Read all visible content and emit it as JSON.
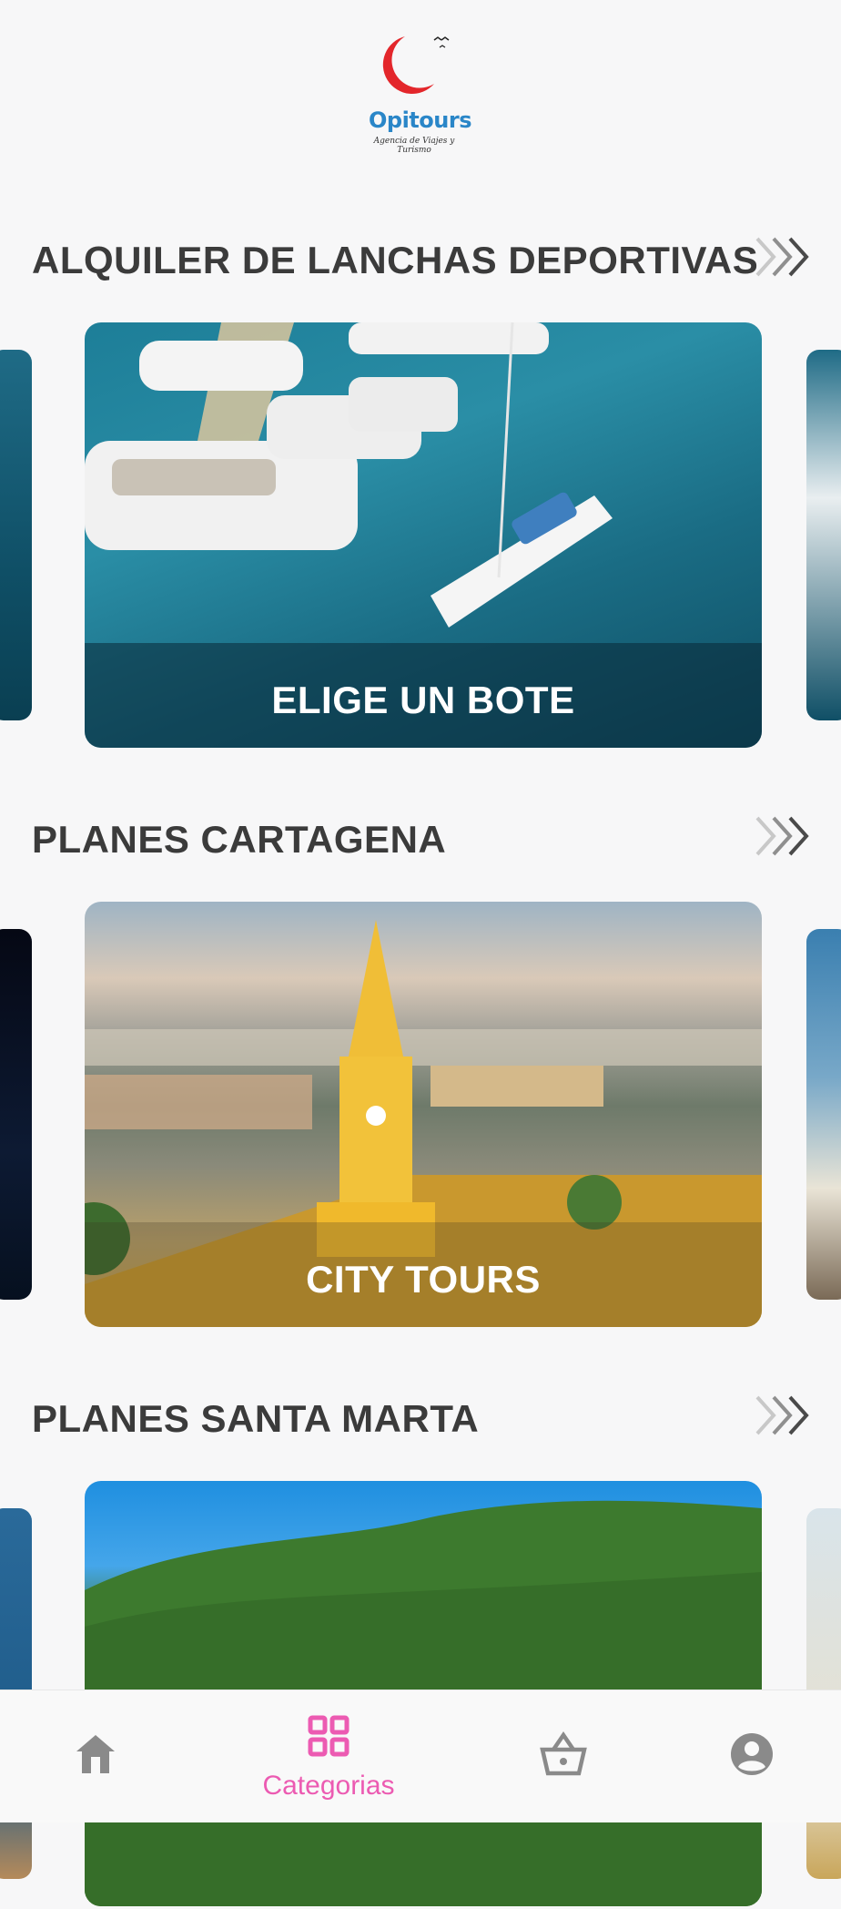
{
  "app": {
    "logo_name": "Opitours",
    "logo_tagline": "Agencia de Viajes y Turismo"
  },
  "sections": [
    {
      "title": "ALQUILER DE  LANCHAS DEPORTIVAS",
      "card_caption": "ELIGE UN BOTE",
      "more_icon": "double-chevron-right-icon"
    },
    {
      "title": "PLANES CARTAGENA",
      "card_caption": "CITY TOURS",
      "more_icon": "double-chevron-right-icon"
    },
    {
      "title": "PLANES SANTA MARTA",
      "card_caption": "",
      "more_icon": "double-chevron-right-icon"
    }
  ],
  "bottom_nav": {
    "items": [
      {
        "icon": "home-icon",
        "label": ""
      },
      {
        "icon": "grid-icon",
        "label": "Categorias",
        "active": true
      },
      {
        "icon": "basket-icon",
        "label": ""
      },
      {
        "icon": "account-icon",
        "label": ""
      }
    ]
  },
  "colors": {
    "accent": "#ec5bb2",
    "title": "#3b3b3b",
    "icon_inactive": "#8a8a8a",
    "logo_blue": "#2a86c8"
  }
}
